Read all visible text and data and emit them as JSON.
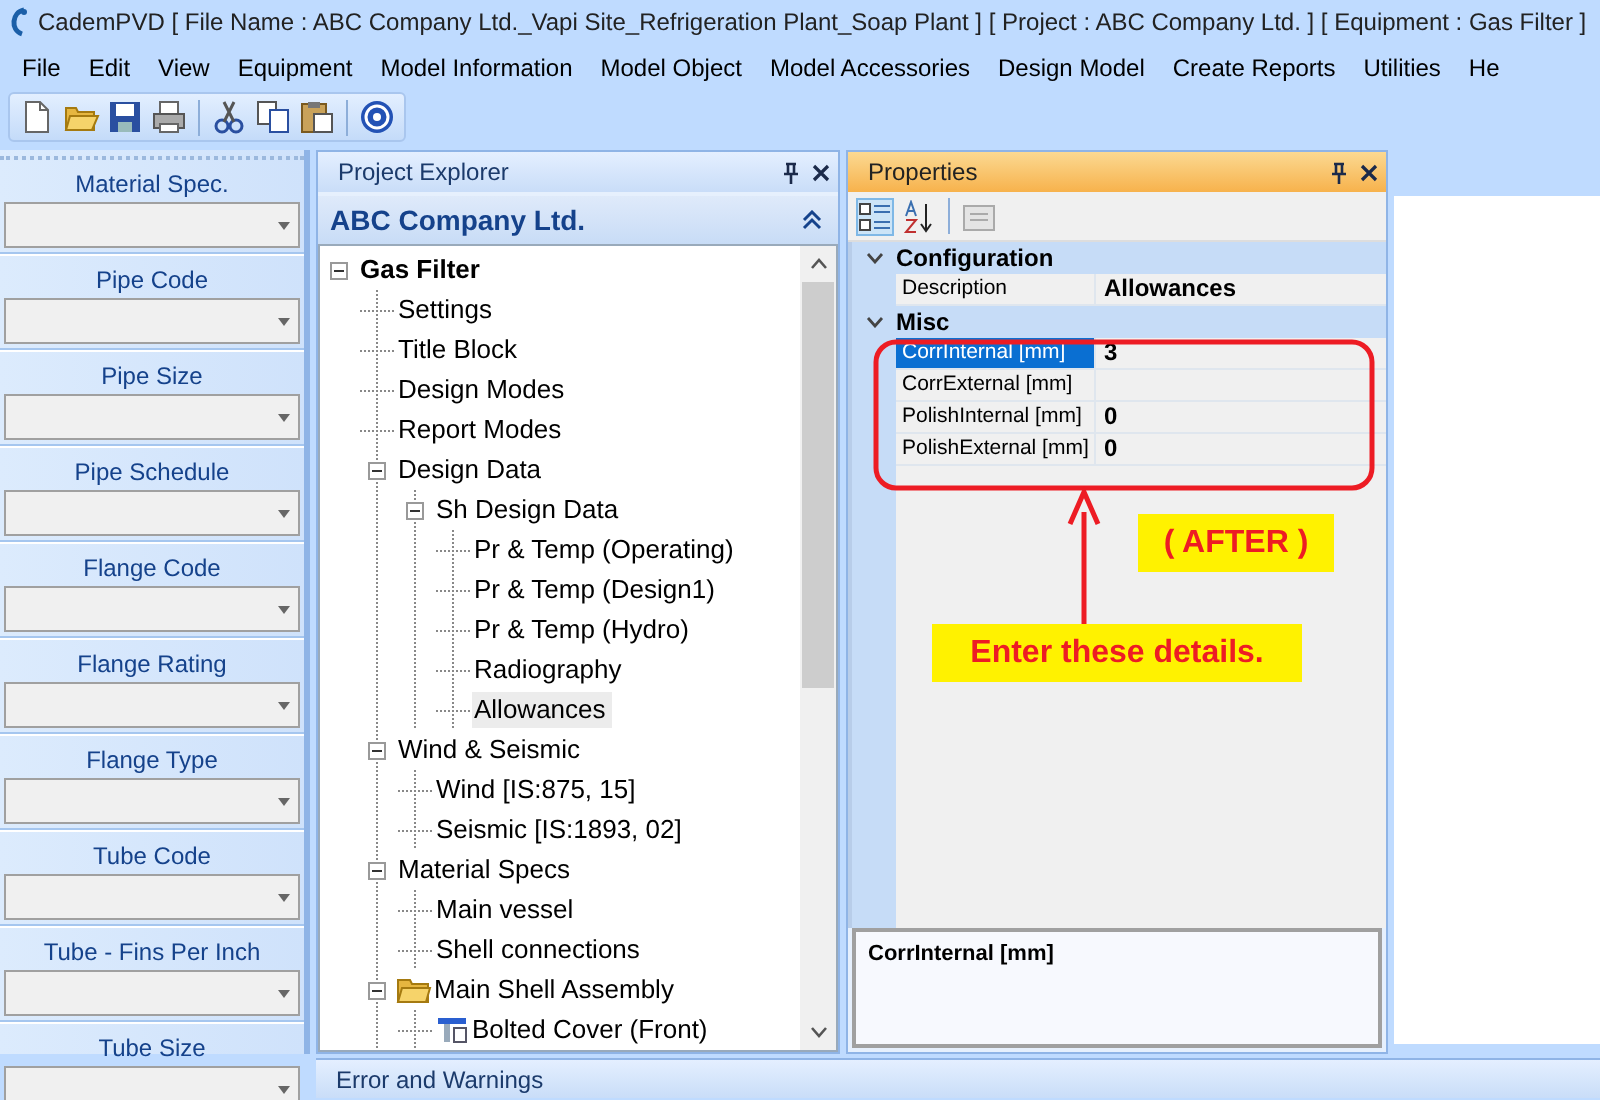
{
  "window": {
    "title": "CademPVD [ File Name : ABC Company Ltd._Vapi Site_Refrigeration Plant_Soap Plant ] [ Project : ABC Company Ltd. ] [ Equipment : Gas Filter ]"
  },
  "menu": [
    "File",
    "Edit",
    "View",
    "Equipment",
    "Model Information",
    "Model Object",
    "Model Accessories",
    "Design Model",
    "Create Reports",
    "Utilities",
    "He"
  ],
  "left_panel": {
    "fields": [
      {
        "label": "Material Spec."
      },
      {
        "label": "Pipe Code"
      },
      {
        "label": "Pipe Size"
      },
      {
        "label": "Pipe Schedule"
      },
      {
        "label": "Flange Code"
      },
      {
        "label": "Flange Rating"
      },
      {
        "label": "Flange Type"
      },
      {
        "label": "Tube Code"
      },
      {
        "label": "Tube - Fins Per Inch"
      },
      {
        "label": "Tube Size"
      }
    ]
  },
  "project_explorer": {
    "title": "Project Explorer",
    "header": "ABC Company Ltd.",
    "tree": [
      {
        "label": "Gas Filter",
        "selected": false,
        "expanded": true,
        "children": [
          {
            "label": "Settings",
            "selected": false
          },
          {
            "label": "Title Block",
            "selected": false
          },
          {
            "label": "Design Modes",
            "selected": false
          },
          {
            "label": "Report Modes",
            "selected": false
          },
          {
            "label": "Design Data",
            "selected": false,
            "expanded": true,
            "children": [
              {
                "label": "Sh Design Data",
                "selected": false,
                "expanded": true,
                "children": [
                  {
                    "label": "Pr & Temp (Operating)",
                    "selected": false
                  },
                  {
                    "label": "Pr & Temp (Design1)",
                    "selected": false
                  },
                  {
                    "label": "Pr & Temp (Hydro)",
                    "selected": false
                  },
                  {
                    "label": "Radiography",
                    "selected": false
                  },
                  {
                    "label": "Allowances",
                    "selected": true
                  }
                ]
              }
            ]
          },
          {
            "label": "Wind & Seismic",
            "selected": false,
            "expanded": true,
            "children": [
              {
                "label": "Wind [IS:875, 15]",
                "selected": false
              },
              {
                "label": "Seismic [IS:1893, 02]",
                "selected": false
              }
            ]
          },
          {
            "label": "Material Specs",
            "selected": false,
            "expanded": true,
            "children": [
              {
                "label": "Main vessel",
                "selected": false
              },
              {
                "label": "Shell connections",
                "selected": false
              }
            ]
          },
          {
            "label": "Main Shell Assembly",
            "kind": "folder",
            "selected": false,
            "expanded": true,
            "children": [
              {
                "label": "Bolted Cover (Front)",
                "kind": "part",
                "selected": false
              }
            ]
          }
        ]
      }
    ]
  },
  "properties": {
    "title": "Properties",
    "categories": [
      {
        "name": "Configuration",
        "expanded": true,
        "rows": [
          {
            "label": "Description",
            "value": "Allowances",
            "selected": false
          }
        ]
      },
      {
        "name": "Misc",
        "expanded": true,
        "rows": [
          {
            "label": "CorrInternal [mm]",
            "value": "3",
            "selected": true
          },
          {
            "label": "CorrExternal [mm]",
            "selected": false
          },
          {
            "label": "PolishInternal [mm]",
            "value": "0",
            "selected": false
          },
          {
            "label": "PolishExternal [mm]",
            "value": "0",
            "selected": false
          }
        ]
      }
    ],
    "description": "CorrInternal [mm]"
  },
  "annotations": {
    "callout": "( AFTER )",
    "instruction": "Enter these details."
  },
  "bottom_panel": {
    "title": "Error and Warnings"
  }
}
